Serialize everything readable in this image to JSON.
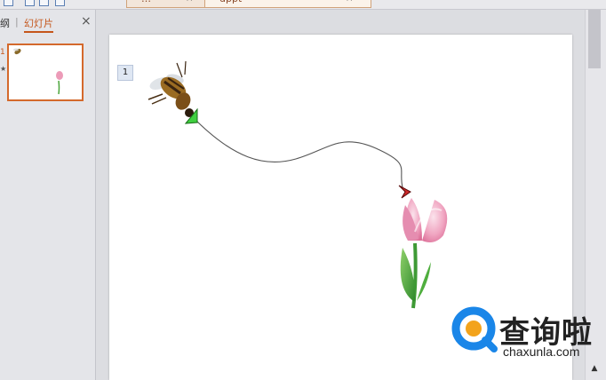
{
  "tabs": [
    {
      "label": "…",
      "close": "×"
    },
    {
      "label": "dppt",
      "close": "×"
    }
  ],
  "left_pane": {
    "tab_outline": "纲",
    "tab_separator": "|",
    "tab_slides": "幻灯片",
    "close_glyph": "×",
    "slide_number": "1",
    "animation_marker": "★"
  },
  "slide": {
    "animation_badge": "1"
  },
  "scrollbar": {
    "up_glyph": "▲"
  },
  "watermark": {
    "title": "查询啦",
    "site": "chaxunla.com"
  },
  "colors": {
    "accent_orange": "#d4692c",
    "path_start": "#3fcf3f",
    "path_end": "#cc2a2a",
    "watermark_blue": "#1a86e8",
    "watermark_orange": "#f3a31b"
  }
}
